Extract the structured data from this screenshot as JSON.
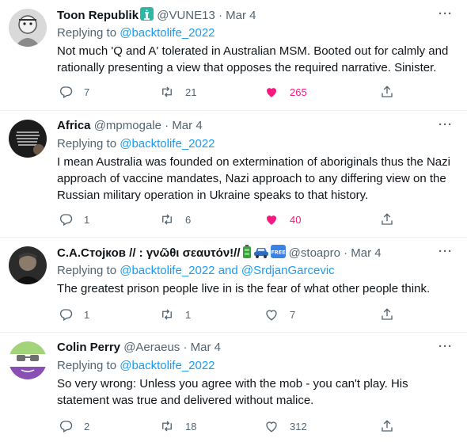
{
  "tweets": [
    {
      "name": "Toon Republik",
      "badge_icon": "statue-of-liberty-emoji",
      "handle": "@VUNE13",
      "time": "Mar 4",
      "replying_prefix": "Replying to",
      "replying_to": [
        "@backtolife_2022"
      ],
      "replying_joiner": "",
      "text": "Not much 'Q and A' tolerated in Australian MSM. Booted out for calmly and rationally presenting a view that opposes the required narrative. Sinister.",
      "replies": "7",
      "retweets": "21",
      "likes": "265",
      "liked": true
    },
    {
      "name": "Africa",
      "handle": "@mpmogale",
      "time": "Mar 4",
      "replying_prefix": "Replying to",
      "replying_to": [
        "@backtolife_2022"
      ],
      "replying_joiner": "",
      "text": "I mean Australia was founded on extermination of aboriginals thus the Nazi approach of vaccine mandates, Nazi approach to any differing view on the Russian military operation in Ukraine speaks to that history.",
      "replies": "1",
      "retweets": "6",
      "likes": "40",
      "liked": true
    },
    {
      "name": "С.А.Стојков // : γνῶθι σεαυτόν!//",
      "name_emojis": [
        "battery-emoji",
        "car-emoji",
        "free-button-emoji"
      ],
      "handle": "@stoapro",
      "time": "Mar 4",
      "replying_prefix": "Replying to",
      "replying_to": [
        "@backtolife_2022",
        "@SrdjanGarcevic"
      ],
      "replying_joiner": "and",
      "text": "The greatest prison people live in is the fear of what other people think.",
      "replies": "1",
      "retweets": "1",
      "likes": "7",
      "liked": false
    },
    {
      "name": "Colin Perry",
      "handle": "@Aeraeus",
      "time": "Mar 4",
      "replying_prefix": "Replying to",
      "replying_to": [
        "@backtolife_2022"
      ],
      "replying_joiner": "",
      "text": "So very wrong: Unless you agree with the mob - you can't play. His statement was true and delivered without malice.",
      "replies": "2",
      "retweets": "18",
      "likes": "312",
      "liked": false
    }
  ],
  "sep": "·",
  "more_glyph": "···",
  "free_badge_text": "FREE",
  "colors": {
    "link": "#1d9bf0",
    "muted": "#536471",
    "like": "#f91880",
    "text": "#0f1419",
    "divider": "#eff3f4"
  }
}
